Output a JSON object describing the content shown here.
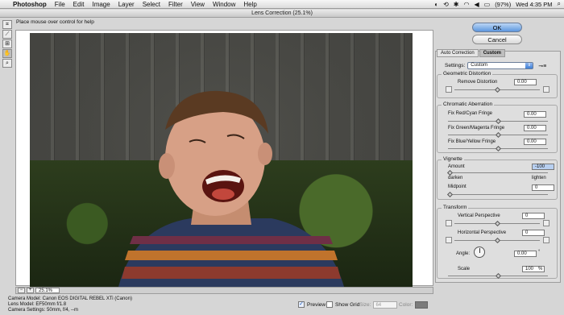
{
  "menubar": {
    "app": "Photoshop",
    "items": [
      "File",
      "Edit",
      "Image",
      "Layer",
      "Select",
      "Filter",
      "View",
      "Window",
      "Help"
    ],
    "battery": "(97%)",
    "clock": "Wed 4:35 PM"
  },
  "window": {
    "title": "Lens Correction (25.1%)",
    "hint": "Place mouse over control for help"
  },
  "zoom": {
    "value": "25.1%"
  },
  "camera": {
    "model": "Camera Model: Canon EOS DIGITAL REBEL XTi (Canon)",
    "lens": "Lens Model: EF50mm f/1.8",
    "settings": "Camera Settings: 50mm, f/4, --m"
  },
  "bottom": {
    "preview_label": "Preview",
    "show_grid_label": "Show Grid",
    "size_label": "Size:",
    "size_value": "64",
    "color_label": "Color:"
  },
  "buttons": {
    "ok": "OK",
    "cancel": "Cancel"
  },
  "tabs": [
    "Auto Correction",
    "Custom"
  ],
  "settings": {
    "label": "Settings:",
    "value": "Custom"
  },
  "geometric": {
    "title": "Geometric Distortion",
    "remove_label": "Remove Distortion",
    "remove_value": "0.00"
  },
  "chromatic": {
    "title": "Chromatic Aberration",
    "red_cyan_label": "Fix Red/Cyan Fringe",
    "red_cyan_value": "0.00",
    "green_magenta_label": "Fix Green/Magenta Fringe",
    "green_magenta_value": "0.00",
    "blue_yellow_label": "Fix Blue/Yellow Fringe",
    "blue_yellow_value": "0.00"
  },
  "vignette": {
    "title": "Vignette",
    "amount_label": "Amount",
    "amount_value": "-100",
    "darken": "darken",
    "lighten": "lighten",
    "midpoint_label": "Midpoint",
    "midpoint_value": "0"
  },
  "transform": {
    "title": "Transform",
    "vertical_label": "Vertical Perspective",
    "vertical_value": "0",
    "horizontal_label": "Horizontal Perspective",
    "horizontal_value": "0",
    "angle_label": "Angle:",
    "angle_value": "0.00",
    "angle_unit": "°",
    "scale_label": "Scale",
    "scale_value": "100",
    "scale_unit": "%"
  }
}
